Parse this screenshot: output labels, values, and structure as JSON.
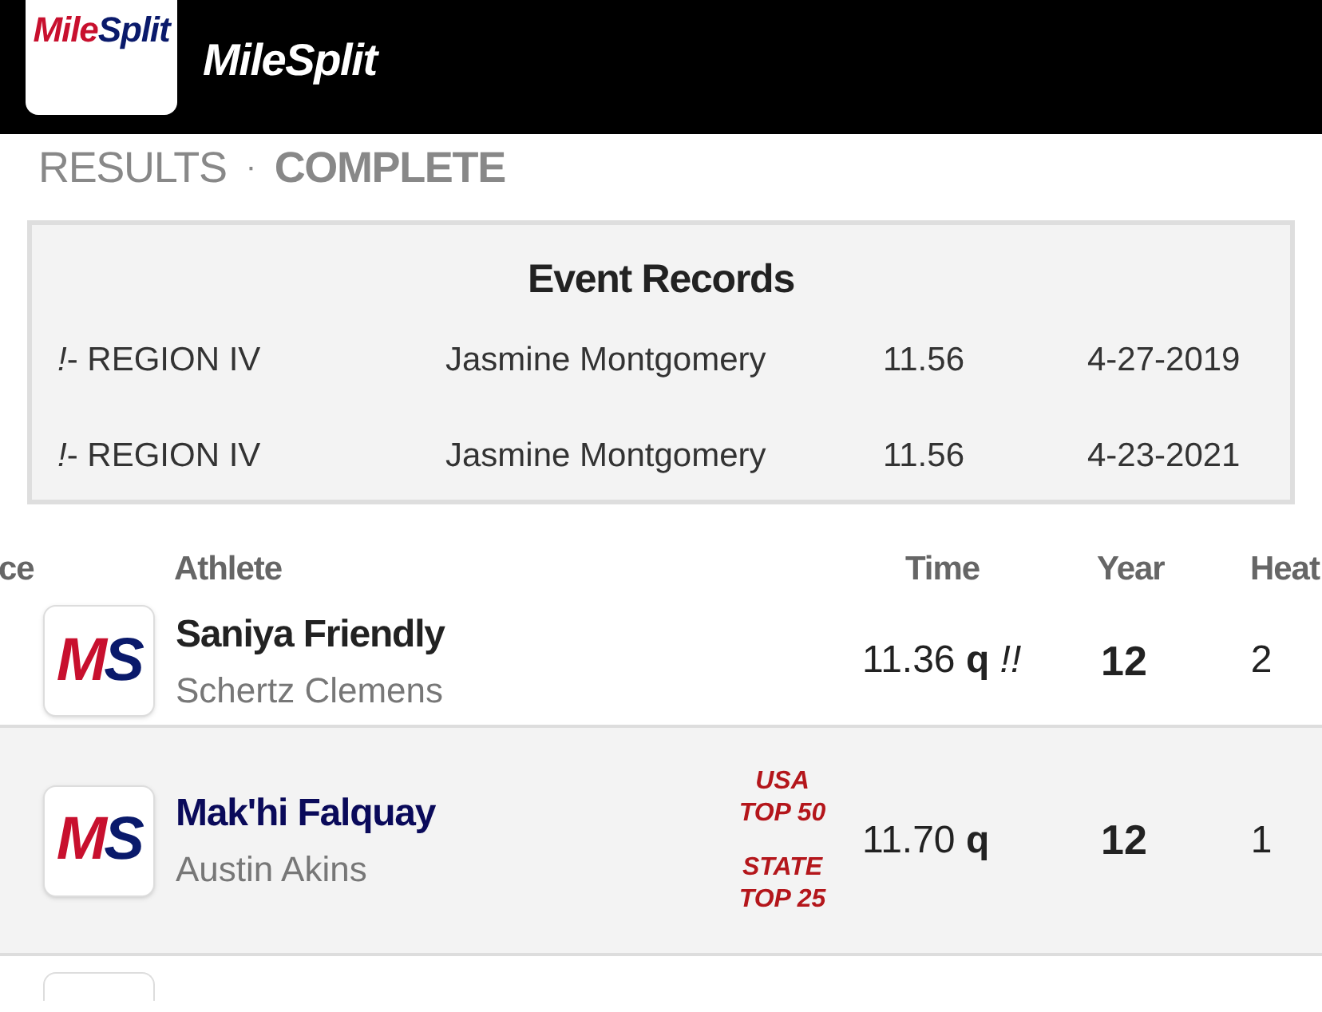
{
  "header": {
    "app_icon": [
      "Mile",
      "Split"
    ],
    "brand": [
      "Mile",
      "Split"
    ]
  },
  "breadcrumb": {
    "section": "RESULTS",
    "separator": "·",
    "status": "COMPLETE"
  },
  "event_records": {
    "title": "Event Records",
    "rows": [
      {
        "label": "*!*- REGION IV",
        "athlete": "Jasmine Montgomery",
        "time": "11.56",
        "date": "4-27-2019"
      },
      {
        "label": "*!*- REGION IV",
        "athlete": "Jasmine Montgomery",
        "time": "11.56",
        "date": "4-23-2021"
      }
    ]
  },
  "results": {
    "columns": [
      "ce",
      "Athlete",
      "Time",
      "Year",
      "Heat"
    ],
    "rows": [
      {
        "logo": [
          "M",
          "S"
        ],
        "name": "Saniya Friendly",
        "team": "Schertz Clemens",
        "badges": [],
        "time": "11.36 **q** *!!*",
        "year": "12",
        "heat": "2",
        "selected": false
      },
      {
        "logo": [
          "M",
          "S"
        ],
        "name": "Mak'hi Falquay",
        "team": "Austin Akins",
        "badges": [
          [
            "USA",
            "TOP 50"
          ],
          [
            "STATE",
            "TOP 25"
          ]
        ],
        "time": "11.70 **q**",
        "year": "12",
        "heat": "1",
        "selected": true
      }
    ]
  }
}
